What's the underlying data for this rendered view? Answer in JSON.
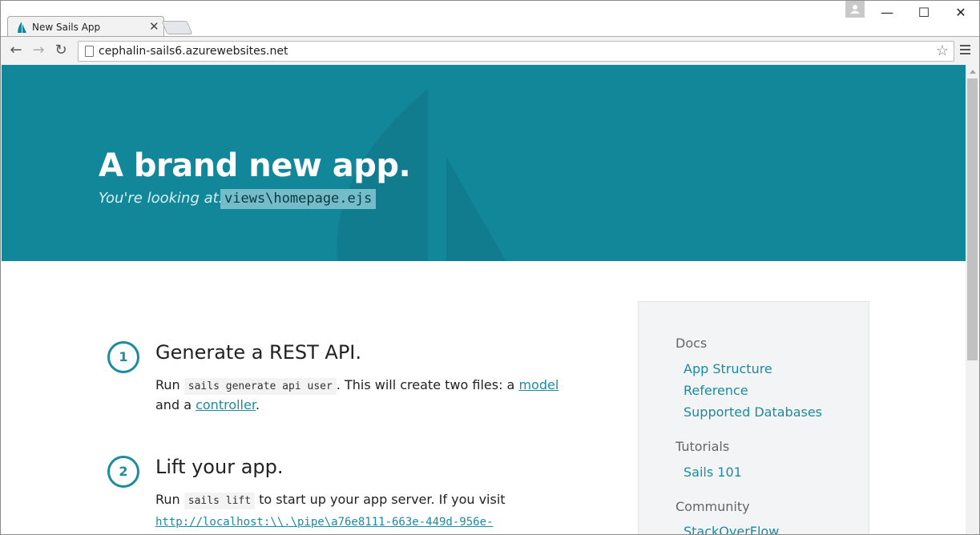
{
  "browser": {
    "tab_title": "New Sails App",
    "tab_close": "✕",
    "url": "cephalin-sails6.azurewebsites.net",
    "controls": {
      "minimize": "—",
      "maximize": "☐",
      "close": "✕"
    },
    "nav": {
      "back": "←",
      "forward": "→",
      "reload": "↻",
      "star": "☆"
    }
  },
  "hero": {
    "title": "A brand new app.",
    "subtitle": "You're looking at:",
    "code": "views\\homepage.ejs"
  },
  "steps": [
    {
      "number": "1",
      "title": "Generate a REST API.",
      "line1_pre": "Run",
      "line1_code": "sails generate api user",
      "line1_post": ". This will create two files: a",
      "line1_link": "model",
      "line2_pre": "and a",
      "line2_link": "controller",
      "line2_post": "."
    },
    {
      "number": "2",
      "title": "Lift your app.",
      "line1_pre": "Run",
      "line1_code": "sails lift",
      "line1_post": "to start up your app server. If you visit",
      "line2_link": "http://localhost:\\\\.\\pipe\\a76e8111-663e-449d-956e-"
    }
  ],
  "sidebar": {
    "sections": [
      {
        "heading": "Docs",
        "links": [
          "App Structure",
          "Reference",
          "Supported Databases"
        ]
      },
      {
        "heading": "Tutorials",
        "links": [
          "Sails 101"
        ]
      },
      {
        "heading": "Community",
        "links": [
          "StackOverFlow"
        ]
      }
    ]
  },
  "colors": {
    "brand": "#13879a",
    "accent": "#1b8b9f"
  }
}
